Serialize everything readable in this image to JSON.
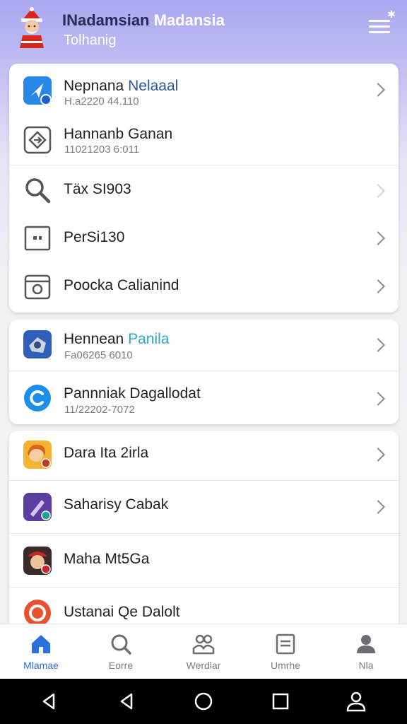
{
  "header": {
    "title_dark": "INadamsian",
    "title_light": "Madansia",
    "subtitle": "Tolhanig"
  },
  "groups": [
    {
      "items": [
        {
          "title": "Nepnana",
          "title_highlight": "Nelaaal",
          "subtitle": "H.a2220 44.110",
          "icon": "navigation-arrow-icon",
          "chevron": true
        },
        {
          "title": "Hannanb Ganan",
          "subtitle": "11021203 6:011",
          "icon": "diamond-arrows-icon",
          "chevron": false
        },
        {
          "title": "Täx SI903",
          "subtitle": "",
          "icon": "search-icon",
          "chevron": true
        },
        {
          "title": "PerSi130",
          "subtitle": "",
          "icon": "square-dot-icon",
          "chevron": true
        },
        {
          "title": "Poocka Calianind",
          "subtitle": "",
          "icon": "camera-frame-icon",
          "chevron": true
        }
      ]
    },
    {
      "items": [
        {
          "title": "Hennean",
          "title_highlight": "Panila",
          "subtitle": "Fa06265 6010",
          "icon": "game-app-icon",
          "chevron": true
        },
        {
          "title": "Pannniak Dagallodat",
          "subtitle": "11/22202-7072",
          "icon": "chat-bubble-icon",
          "chevron": true
        }
      ]
    },
    {
      "items": [
        {
          "title": "Dara Ita 2irla",
          "subtitle": "",
          "icon": "character-avatar-icon",
          "chevron": true
        },
        {
          "title": "Saharisy Cabak",
          "subtitle": "",
          "icon": "purple-app-icon",
          "chevron": true
        },
        {
          "title": "Maha Mt5Ga",
          "subtitle": "",
          "icon": "red-hat-avatar-icon",
          "chevron": false
        },
        {
          "title": "Ustanai Qe Dalolt",
          "subtitle": "",
          "icon": "orange-circle-icon",
          "chevron": false
        }
      ]
    }
  ],
  "bottom_nav": [
    {
      "label": "Mlamae",
      "icon": "home-icon",
      "active": true
    },
    {
      "label": "Eorre",
      "icon": "search-icon",
      "active": false
    },
    {
      "label": "Werdlar",
      "icon": "people-icon",
      "active": false
    },
    {
      "label": "Umrhe",
      "icon": "document-icon",
      "active": false
    },
    {
      "label": "Nla",
      "icon": "profile-icon",
      "active": false
    }
  ],
  "colors": {
    "accent": "#2c6fe0",
    "header_gradient_top": "#a9a7f0"
  }
}
